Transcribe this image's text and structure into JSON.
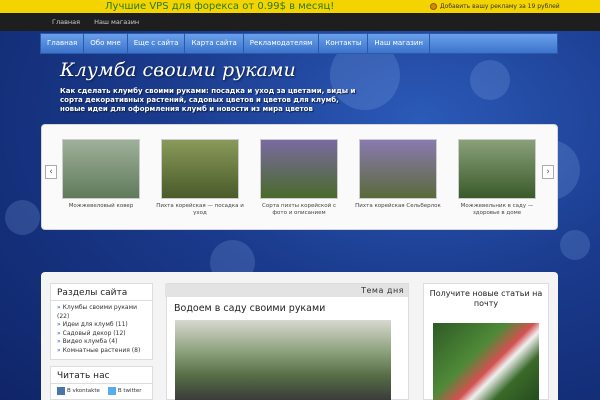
{
  "ad_bar": {
    "left_text": "Лучшие VPS для форекса от 0.99$ в месяц!",
    "right_text": "Добавить вашу рекламу за 19 рублей"
  },
  "top_links": [
    "Главная",
    "Наш магазин"
  ],
  "main_nav": [
    "Главная",
    "Обо мне",
    "Еще с сайта",
    "Карта сайта",
    "Рекламодателям",
    "Контакты",
    "Наш магазин"
  ],
  "site": {
    "title": "Клумба своими руками",
    "tagline": "Как сделать клумбу своими руками: посадка и уход за цветами, виды и сорта декоративных растений, садовых цветов и цветов для клумб, новые идеи для оформления клумб и новости из мира цветов"
  },
  "slider": {
    "prev_glyph": "‹",
    "next_glyph": "›",
    "items": [
      {
        "caption": "Можжевеловый ковер",
        "color": "#6f8a6a"
      },
      {
        "caption": "Пихта корейская — посадка и уход",
        "color": "#7a8a4a"
      },
      {
        "caption": "Сорта пихты корейской с фото и описанием",
        "color": "#5a7a3a"
      },
      {
        "caption": "Пихта корейская Сельберлок",
        "color": "#6e7e5a"
      },
      {
        "caption": "Можжевельник в саду — здоровье в доме",
        "color": "#6a8a5a"
      }
    ]
  },
  "sidebar": {
    "sections_title": "Разделы сайта",
    "sections": [
      "Клумбы своими руками (22)",
      "Идеи для клумб (11)",
      "Садовый декор (12)",
      "Видео клумба (4)",
      "Комнатные растения (8)"
    ],
    "read_title": "Читать нас",
    "social": [
      "В vkontakte",
      "В twitter"
    ]
  },
  "featured": {
    "tag": "Тема дня",
    "title": "Водоем в саду своими руками"
  },
  "subscribe": {
    "title": "Получите новые статьи на почту"
  }
}
